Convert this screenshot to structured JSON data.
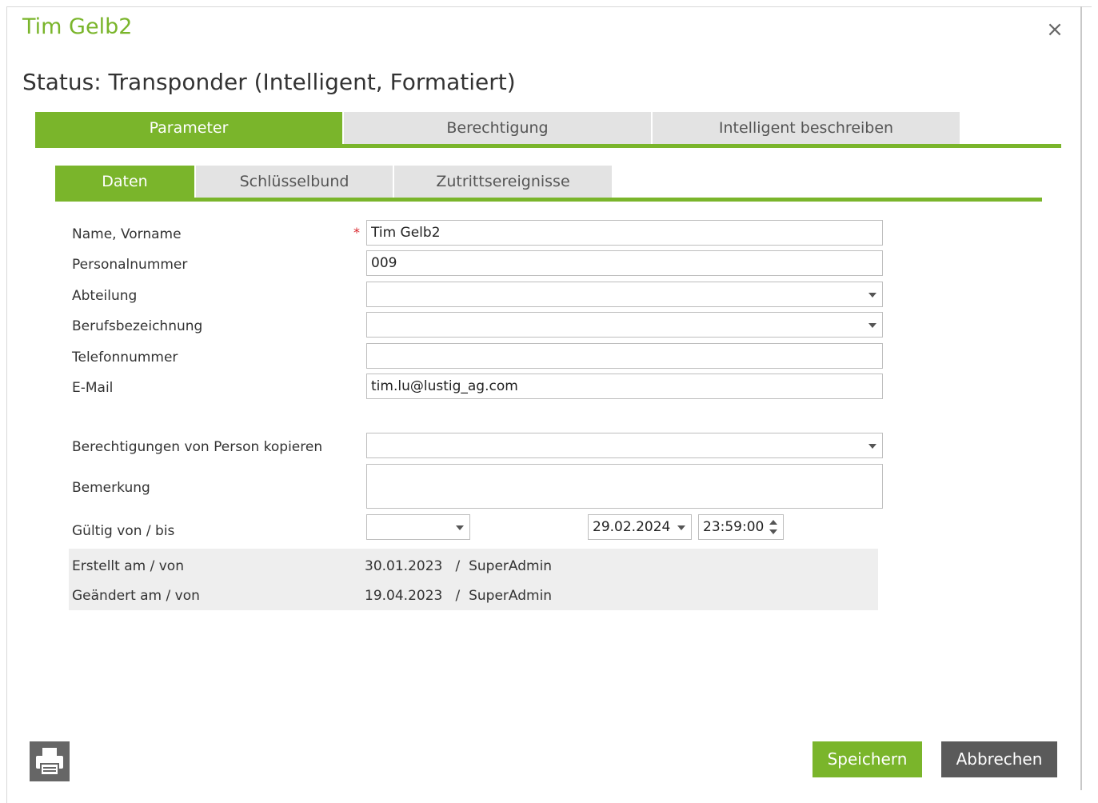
{
  "dialog": {
    "title": "Tim Gelb2",
    "status": "Status: Transponder (Intelligent, Formatiert)",
    "close_icon": "×"
  },
  "main_tabs": [
    "Parameter",
    "Berechtigung",
    "Intelligent beschreiben"
  ],
  "sub_tabs": [
    "Daten",
    "Schlüsselbund",
    "Zutrittsereignisse"
  ],
  "form": {
    "name_label": "Name, Vorname",
    "name_value": "Tim Gelb2",
    "required_marker": "*",
    "personalnummer_label": "Personalnummer",
    "personalnummer_value": "009",
    "abteilung_label": "Abteilung",
    "abteilung_value": "",
    "beruf_label": "Berufsbezeichnung",
    "beruf_value": "",
    "telefon_label": "Telefonnummer",
    "telefon_value": "",
    "email_label": "E-Mail",
    "email_value": "tim.lu@lustig_ag.com",
    "copy_label": "Berechtigungen von Person kopieren",
    "copy_value": "",
    "bemerkung_label": "Bemerkung",
    "bemerkung_value": "",
    "gueltig_label": "Gültig von / bis",
    "gueltig_von": "",
    "gueltig_bis_date": "29.02.2024",
    "gueltig_bis_time": "23:59:00"
  },
  "info": {
    "erstellt_label": "Erstellt am / von",
    "erstellt_value": "30.01.2023   /  SuperAdmin",
    "geaendert_label": "Geändert am / von",
    "geaendert_value": "19.04.2023   /  SuperAdmin"
  },
  "buttons": {
    "print_icon": "printer-icon",
    "save": "Speichern",
    "cancel": "Abbrechen"
  },
  "colors": {
    "accent": "#7ab52b",
    "required": "#d9252b",
    "cancel_bg": "#5a5a5a"
  }
}
